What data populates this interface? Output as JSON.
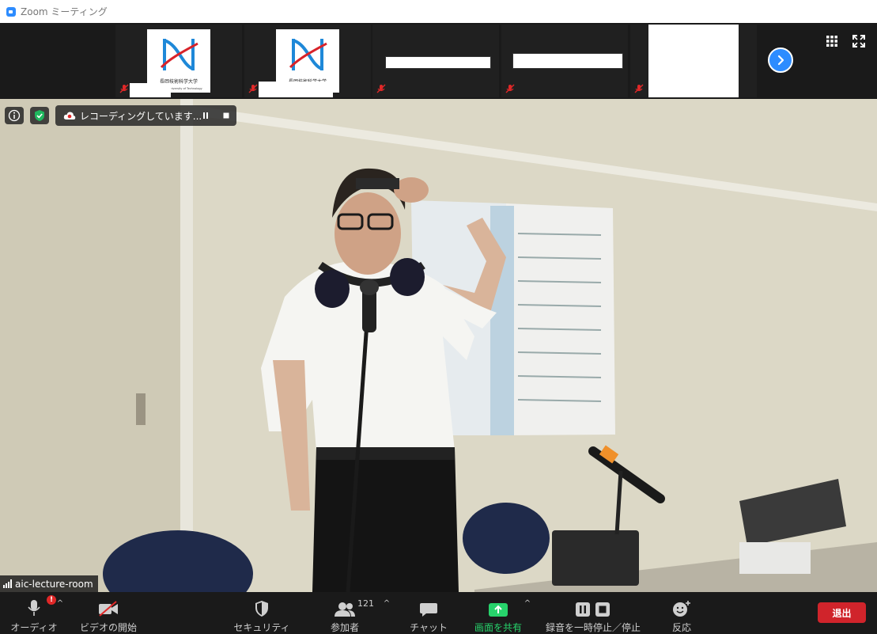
{
  "window": {
    "title": "Zoom ミーティング"
  },
  "thumbnails": {
    "logo_text_ja": "長岡技術科学大学",
    "logo_text_en": "Nagaoka University of Technology"
  },
  "recording": {
    "status_text": "レコーディングしています..."
  },
  "speaker": {
    "name": "aic-lecture-room"
  },
  "toolbar": {
    "audio_label": "オーディオ",
    "video_label": "ビデオの開始",
    "security_label": "セキュリティ",
    "participants_label": "参加者",
    "participants_count": "121",
    "chat_label": "チャット",
    "share_label": "画面を共有",
    "record_label": "録音を一時停止／停止",
    "reactions_label": "反応",
    "leave_label": "退出",
    "audio_badge": "!"
  },
  "colors": {
    "accent": "#2d8cff",
    "share_green": "#27d36b",
    "leave_red": "#d0242b",
    "security_green": "#1fb85e"
  }
}
